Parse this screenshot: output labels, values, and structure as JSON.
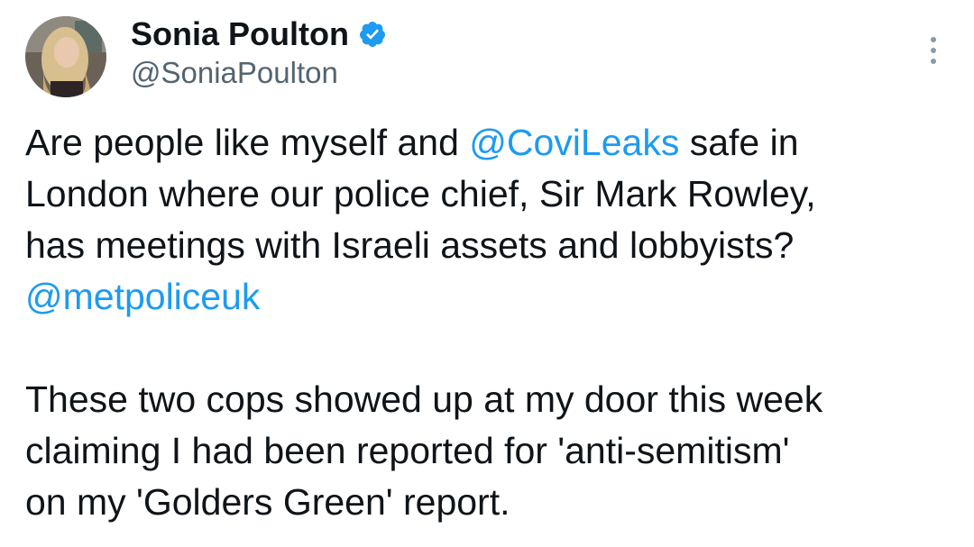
{
  "author": {
    "display_name": "Sonia Poulton",
    "handle": "@SoniaPoulton",
    "verified_icon": "verified-badge-icon",
    "avatar_icon": "profile-photo"
  },
  "menu": {
    "icon": "more-vertical-icon"
  },
  "tweet": {
    "p1": {
      "l1_a": "Are people like myself and ",
      "l1_mention": "@CoviLeaks",
      "l1_b": " safe in",
      "l2": "London where our police chief, Sir Mark Rowley,",
      "l3": "has meetings with Israeli assets and lobbyists?",
      "l4_mention": "@metpoliceuk"
    },
    "p2": {
      "l1": "These two cops showed up at my door this week",
      "l2": "claiming I had been reported for 'anti-semitism'",
      "l3": "on my 'Golders Green' report."
    }
  },
  "colors": {
    "text": "#0f1419",
    "secondary": "#536471",
    "mention": "#1d9bf0",
    "verified": "#1d9bf0"
  }
}
